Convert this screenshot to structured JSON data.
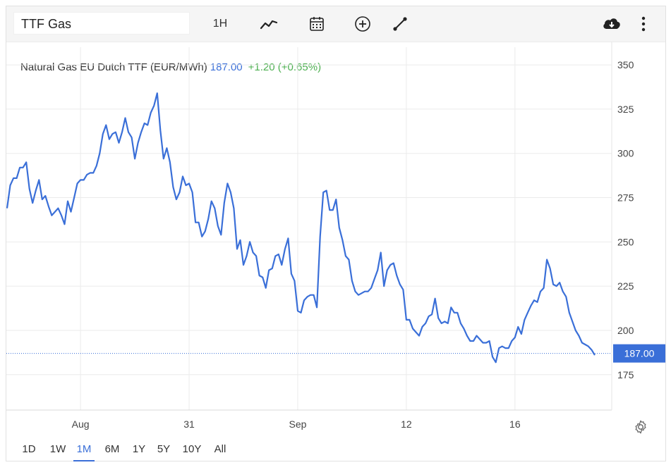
{
  "toolbar": {
    "symbol": "TTF Gas",
    "interval_label": "1H",
    "icons": [
      "line-chart-icon",
      "calendar-icon",
      "plus-circle-icon",
      "draw-line-icon",
      "cloud-download-icon",
      "more-vertical-icon"
    ]
  },
  "legend": {
    "name": "Natural Gas EU Dutch TTF (EUR/MWh)",
    "price": "187.00",
    "change": "+1.20 (+0.65%)"
  },
  "price_tag": "187.00",
  "ranges": [
    "1D",
    "1W",
    "1M",
    "6M",
    "1Y",
    "5Y",
    "10Y",
    "All"
  ],
  "active_range": "1M",
  "colors": {
    "line": "#3a6fd8",
    "change_up": "#4caf50",
    "grid": "#ebebeb"
  },
  "chart_data": {
    "type": "line",
    "title": "Natural Gas EU Dutch TTF (EUR/MWh)",
    "ylim": [
      155,
      360
    ],
    "y_ticks": [
      350,
      325,
      300,
      275,
      250,
      225,
      200,
      175
    ],
    "x_ticks": [
      "Aug",
      "31",
      "Sep",
      "12",
      "16"
    ],
    "x_tick_index": [
      23,
      57,
      91,
      125,
      159
    ],
    "last_price": 187.0,
    "grid": true,
    "series": [
      {
        "values": [
          269,
          282,
          286,
          286,
          292,
          292,
          295,
          280,
          272,
          279,
          285,
          274,
          276,
          270,
          265,
          267,
          269,
          265,
          260,
          273,
          267,
          275,
          283,
          285,
          285,
          288,
          289,
          289,
          293,
          300,
          311,
          316,
          308,
          311,
          312,
          306,
          312,
          320,
          312,
          309,
          297,
          306,
          312,
          317,
          316,
          323,
          327,
          334,
          313,
          297,
          303,
          295,
          281,
          274,
          278,
          287,
          282,
          283,
          278,
          261,
          261,
          253,
          256,
          263,
          273,
          269,
          259,
          254,
          272,
          283,
          278,
          269,
          246,
          251,
          237,
          242,
          250,
          244,
          242,
          231,
          230,
          224,
          234,
          235,
          242,
          243,
          237,
          246,
          252,
          232,
          228,
          211,
          210,
          217,
          219,
          220,
          220,
          213,
          253,
          278,
          279,
          268,
          268,
          274,
          258,
          251,
          242,
          240,
          228,
          222,
          220,
          221,
          222,
          222,
          224,
          229,
          234,
          244,
          225,
          234,
          237,
          238,
          231,
          226,
          223,
          206,
          206,
          201,
          199,
          197,
          202,
          204,
          208,
          209,
          218,
          207,
          204,
          205,
          204,
          213,
          210,
          210,
          204,
          201,
          197,
          194,
          194,
          197,
          195,
          193,
          193,
          194,
          185,
          182,
          190,
          191,
          190,
          190,
          194,
          196,
          202,
          198,
          206,
          210,
          214,
          217,
          216,
          222,
          224,
          240,
          235,
          226,
          225,
          227,
          222,
          219,
          210,
          205,
          200,
          197,
          193,
          192,
          191,
          189,
          186
        ]
      }
    ]
  }
}
